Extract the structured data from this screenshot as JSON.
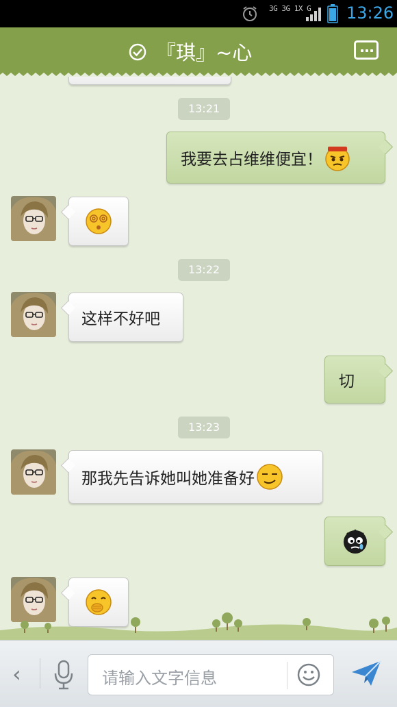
{
  "status_bar": {
    "network": "3G 3G 1X G",
    "time": "13:26"
  },
  "header": {
    "title": "『琪』~心",
    "colors": {
      "accent": "#84a04a"
    }
  },
  "messages": [
    {
      "type": "time",
      "text": "13:21"
    },
    {
      "type": "out",
      "text": "我要去占维维便宜！",
      "emoji": "angry-face"
    },
    {
      "type": "in",
      "text": "",
      "emoji": "dizzy-face"
    },
    {
      "type": "time",
      "text": "13:22"
    },
    {
      "type": "in",
      "text": "这样不好吧",
      "emoji": ""
    },
    {
      "type": "out",
      "text": "切",
      "emoji": ""
    },
    {
      "type": "time",
      "text": "13:23"
    },
    {
      "type": "in",
      "text": "那我先告诉她叫她准备好",
      "emoji": "smug-face"
    },
    {
      "type": "out",
      "text": "",
      "emoji": "crying-black-blob"
    },
    {
      "type": "in",
      "text": "",
      "emoji": "giggle-face"
    }
  ],
  "input": {
    "placeholder": "请输入文字信息"
  }
}
